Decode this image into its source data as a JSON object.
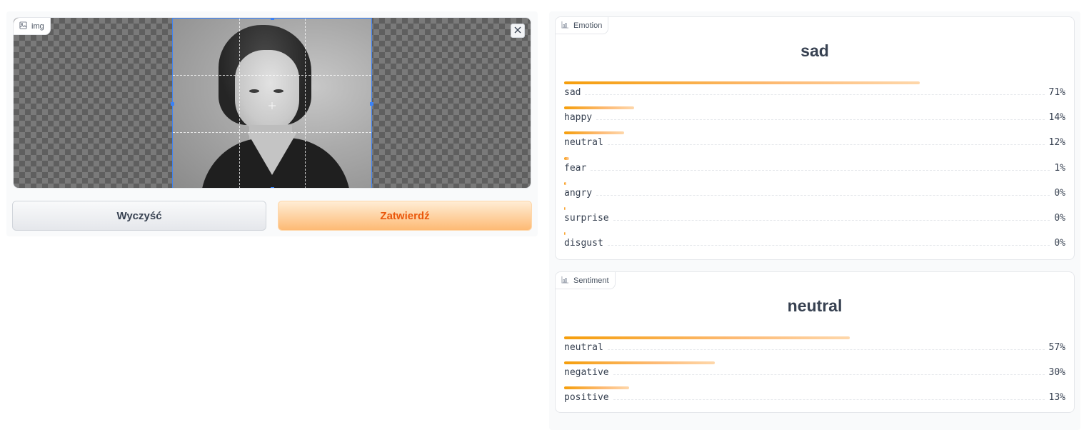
{
  "image_input": {
    "label": "img"
  },
  "buttons": {
    "clear": "Wyczyść",
    "submit": "Zatwierdź"
  },
  "emotion": {
    "label": "Emotion",
    "top": "sad",
    "items": [
      {
        "name": "sad",
        "pct": "71%",
        "value": 0.71
      },
      {
        "name": "happy",
        "pct": "14%",
        "value": 0.14
      },
      {
        "name": "neutral",
        "pct": "12%",
        "value": 0.12
      },
      {
        "name": "fear",
        "pct": "1%",
        "value": 0.01
      },
      {
        "name": "angry",
        "pct": "0%",
        "value": 0.004
      },
      {
        "name": "surprise",
        "pct": "0%",
        "value": 0.003
      },
      {
        "name": "disgust",
        "pct": "0%",
        "value": 0.001
      }
    ]
  },
  "sentiment": {
    "label": "Sentiment",
    "top": "neutral",
    "items": [
      {
        "name": "neutral",
        "pct": "57%",
        "value": 0.57
      },
      {
        "name": "negative",
        "pct": "30%",
        "value": 0.3
      },
      {
        "name": "positive",
        "pct": "13%",
        "value": 0.13
      }
    ]
  },
  "colors": {
    "accent": "#f59e0b",
    "crop": "#3b82f6"
  }
}
